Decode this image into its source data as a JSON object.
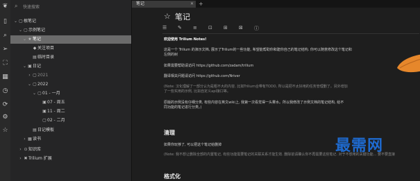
{
  "search": {
    "placeholder": "快速搜索"
  },
  "tree": [
    {
      "label": "根笔记",
      "twisty": "⌄",
      "icon": "▢"
    },
    {
      "label": "示例笔记",
      "twisty": "⌄",
      "icon": "▢"
    },
    {
      "label": "笔记",
      "twisty": "⌄",
      "icon": "★"
    },
    {
      "label": "关注项目",
      "twisty": "",
      "icon": "◆"
    },
    {
      "label": "临时目录",
      "twisty": "",
      "icon": "▤"
    },
    {
      "label": "日记",
      "twisty": "⌄",
      "icon": "▣"
    },
    {
      "label": "2021",
      "twisty": "›",
      "icon": "▢"
    },
    {
      "label": "2022",
      "twisty": "⌄",
      "icon": "▢"
    },
    {
      "label": "01 - 一月",
      "twisty": "⌄",
      "icon": "▢"
    },
    {
      "label": "07 - 周五",
      "twisty": "",
      "icon": "▣"
    },
    {
      "label": "11 - 周二",
      "twisty": "",
      "icon": "▣"
    },
    {
      "label": "02 - 二月",
      "twisty": "",
      "icon": "▢"
    },
    {
      "label": "日记模板",
      "twisty": "",
      "icon": "▤"
    },
    {
      "label": "读书",
      "twisty": "›",
      "icon": "▦"
    },
    {
      "label": "知识库",
      "twisty": "›",
      "icon": "⊙"
    },
    {
      "label": "Trilium 扩展",
      "twisty": "›",
      "icon": "✖"
    }
  ],
  "tab": {
    "label": "笔记",
    "close": "✕",
    "new": "+"
  },
  "note": {
    "title": "笔记",
    "paragraphs": [
      {
        "text": "欢迎使用 Trilium Notes!"
      },
      {
        "text": "这是一个 Trilium 的演示文档, 展示了Trilium的一些功能, 希望能帮助你和建你自己的笔记结构. 你可以随意修改这个笔记和"
      },
      {
        "text": "左侧的树"
      },
      {
        "text": "如果需要帮助请访问  https://github.com/zadam/trilium"
      },
      {
        "text": "翻译相关问题请访问  https://github.com/Nriver"
      },
      {
        "text": "(Note: 汉化理解了一部分认为是粗不大的内容, 比如Trilium合带有TODO, 所以是把不太好用的任务管理删了。另外增加"
      },
      {
        "text": "了一些实用的示例, 比如自定义api接口等。"
      },
      {
        "text": "原版的示例没有仔细分类, 有些内容在英文wiki上, 我第一次看觉得一头雾水。所以我修改了示例文档的笔记结构, 给不"
      },
      {
        "text": "同功能的笔记进行分类。)"
      },
      {
        "text": "清理"
      },
      {
        "text": "如果你玩够了, 可以把这个笔记给删掉"
      },
      {
        "text": "(Note: 我不想让删除全部的内置笔记, 有些功能需要笔记的关联关系才能生效. 删除前请确认你不再需要这些笔记. 对于不想用的关键功能... 要不要直接"
      },
      {
        "text": "格式化"
      }
    ]
  },
  "watermark": "最需网",
  "colors": {
    "accent": "#e6872b",
    "link": "#4e9fd6",
    "selected": "#6b6b6b"
  }
}
